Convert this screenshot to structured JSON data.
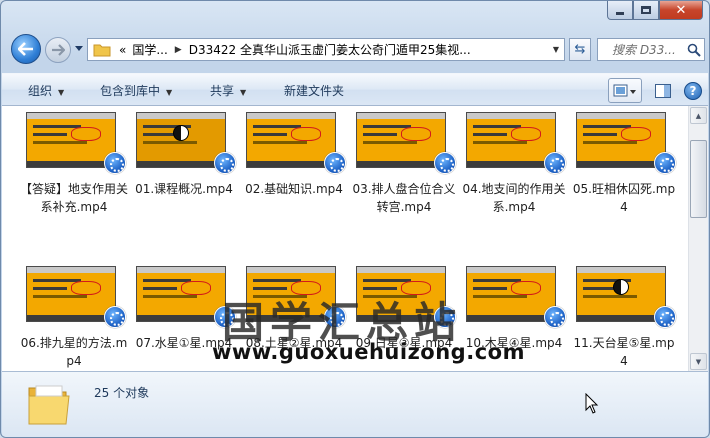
{
  "address": {
    "overflow": "«",
    "segment_1": "国学...",
    "segment_2": "D33422 全真华山派玉虚门姜太公奇门遁甲25集视..."
  },
  "search": {
    "placeholder": "搜索 D33..."
  },
  "toolbar": {
    "organize": "组织",
    "include_in_library": "包含到库中",
    "share": "共享",
    "new_folder": "新建文件夹"
  },
  "files": [
    {
      "name": "【答疑】地支作用关系补充.mp4"
    },
    {
      "name": "01.课程概况.mp4"
    },
    {
      "name": "02.基础知识.mp4"
    },
    {
      "name": "03.排人盘合位合义转宫.mp4"
    },
    {
      "name": "04.地支间的作用关系.mp4"
    },
    {
      "name": "05.旺相休囚死.mp4"
    },
    {
      "name": "06.排九星的方法.mp4"
    },
    {
      "name": "07.水星①星.mp4"
    },
    {
      "name": "08.土星②星.mp4"
    },
    {
      "name": "09.日星③星.mp4"
    },
    {
      "name": "10.木星④星.mp4"
    },
    {
      "name": "11.天台星⑤星.mp4"
    }
  ],
  "watermark": {
    "text": "国学汇总站",
    "url": "www.guoxuehuizong.com"
  },
  "status": {
    "count": "25 个对象"
  },
  "colors": {
    "thumb_bg": "#f3a800",
    "window_frame": "#c3d5ea",
    "badge": "#1b5fc4"
  }
}
